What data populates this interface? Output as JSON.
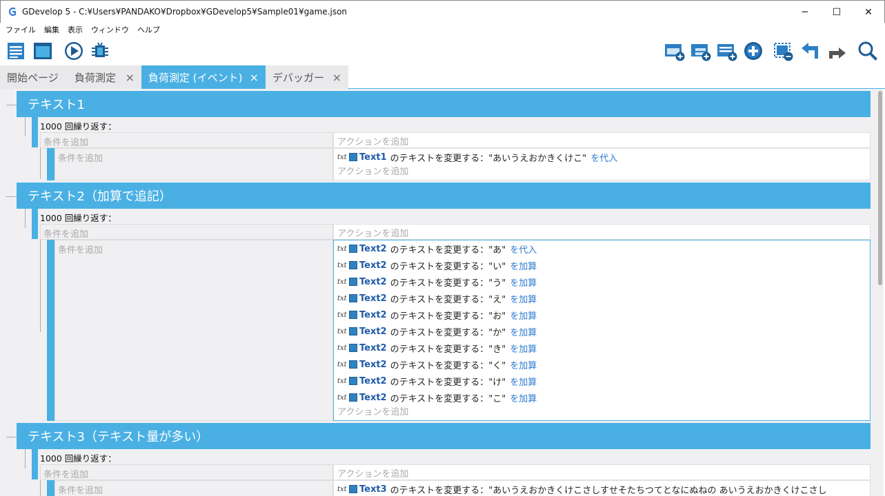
{
  "window": {
    "title": "GDevelop 5 - C:¥Users¥PANDAKO¥Dropbox¥GDevelop5¥Sample01¥game.json",
    "minimize": "─",
    "maximize": "☐",
    "close": "✕"
  },
  "menu": [
    "ファイル",
    "編集",
    "表示",
    "ウィンドウ",
    "ヘルプ"
  ],
  "toolbar": {
    "left": [
      "project-manager-icon",
      "scene-editor-icon",
      "preview-icon",
      "debugger-icon"
    ],
    "right": [
      "add-event-icon",
      "add-subevent-icon",
      "add-other-icon",
      "add-icon",
      "delete-icon",
      "undo-icon",
      "redo-icon",
      "search-icon"
    ]
  },
  "tabs": [
    {
      "label": "開始ページ",
      "closable": false
    },
    {
      "label": "負荷測定",
      "closable": true
    },
    {
      "label": "負荷測定 (イベント)",
      "closable": true,
      "active": true
    },
    {
      "label": "デバッガー",
      "closable": true
    }
  ],
  "tab_close": "×",
  "placeholders": {
    "condition": "条件を追加",
    "action": "アクションを追加"
  },
  "groups": [
    {
      "title": "テキスト1",
      "repeat": "1000 回繰り返す：",
      "actions": [
        {
          "icon": "txt",
          "object": "Text1",
          "desc": "のテキストを変更する：\"あいうえおかきくけこ\"",
          "op": "を代入"
        }
      ]
    },
    {
      "title": "テキスト2（加算で追記）",
      "repeat": "1000 回繰り返す：",
      "actions": [
        {
          "icon": "txt",
          "object": "Text2",
          "desc": "のテキストを変更する：\"あ\"",
          "op": "を代入"
        },
        {
          "icon": "txt",
          "object": "Text2",
          "desc": "のテキストを変更する：\"い\"",
          "op": "を加算"
        },
        {
          "icon": "txt",
          "object": "Text2",
          "desc": "のテキストを変更する：\"う\"",
          "op": "を加算"
        },
        {
          "icon": "txt",
          "object": "Text2",
          "desc": "のテキストを変更する：\"え\"",
          "op": "を加算"
        },
        {
          "icon": "txt",
          "object": "Text2",
          "desc": "のテキストを変更する：\"お\"",
          "op": "を加算"
        },
        {
          "icon": "txt",
          "object": "Text2",
          "desc": "のテキストを変更する：\"か\"",
          "op": "を加算"
        },
        {
          "icon": "txt",
          "object": "Text2",
          "desc": "のテキストを変更する：\"き\"",
          "op": "を加算"
        },
        {
          "icon": "txt",
          "object": "Text2",
          "desc": "のテキストを変更する：\"く\"",
          "op": "を加算"
        },
        {
          "icon": "txt",
          "object": "Text2",
          "desc": "のテキストを変更する：\"け\"",
          "op": "を加算"
        },
        {
          "icon": "txt",
          "object": "Text2",
          "desc": "のテキストを変更する：\"こ\"",
          "op": "を加算"
        }
      ]
    },
    {
      "title": "テキスト3（テキスト量が多い）",
      "repeat": "1000 回繰り返す：",
      "actions": [
        {
          "icon": "txt",
          "object": "Text3",
          "desc": "のテキストを変更する：\"あいうえおかきくけこさしすせそたちつてとなにぬねの あいうえおかきくけこさし",
          "op": ""
        }
      ]
    }
  ],
  "colors": {
    "accent": "#4ab0e4",
    "object_link": "#1e5aa8",
    "operator": "#2e7bd2",
    "placeholder": "#aaaaaa"
  }
}
